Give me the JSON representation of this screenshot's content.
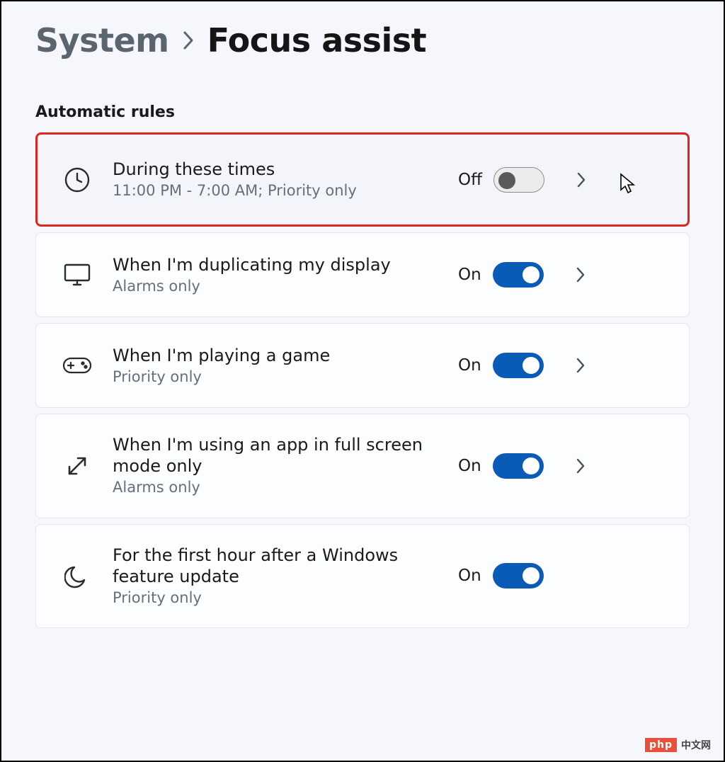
{
  "breadcrumb": {
    "parent": "System",
    "current": "Focus assist"
  },
  "section": {
    "heading": "Automatic rules"
  },
  "rules": [
    {
      "icon": "clock-icon",
      "title": "During these times",
      "subtitle": "11:00 PM - 7:00 AM; Priority only",
      "state_label": "Off",
      "toggle_on": false,
      "has_chevron": true,
      "highlighted": true,
      "cursor_visible": true
    },
    {
      "icon": "monitor-icon",
      "title": "When I'm duplicating my display",
      "subtitle": "Alarms only",
      "state_label": "On",
      "toggle_on": true,
      "has_chevron": true,
      "highlighted": false
    },
    {
      "icon": "gamepad-icon",
      "title": "When I'm playing a game",
      "subtitle": "Priority only",
      "state_label": "On",
      "toggle_on": true,
      "has_chevron": true,
      "highlighted": false
    },
    {
      "icon": "fullscreen-arrow-icon",
      "title": "When I'm using an app in full screen mode only",
      "subtitle": "Alarms only",
      "state_label": "On",
      "toggle_on": true,
      "has_chevron": true,
      "highlighted": false
    },
    {
      "icon": "moon-icon",
      "title": "For the first hour after a Windows feature update",
      "subtitle": "Priority only",
      "state_label": "On",
      "toggle_on": true,
      "has_chevron": false,
      "highlighted": false
    }
  ],
  "watermark": {
    "brand": "php",
    "suffix": "中文网"
  }
}
